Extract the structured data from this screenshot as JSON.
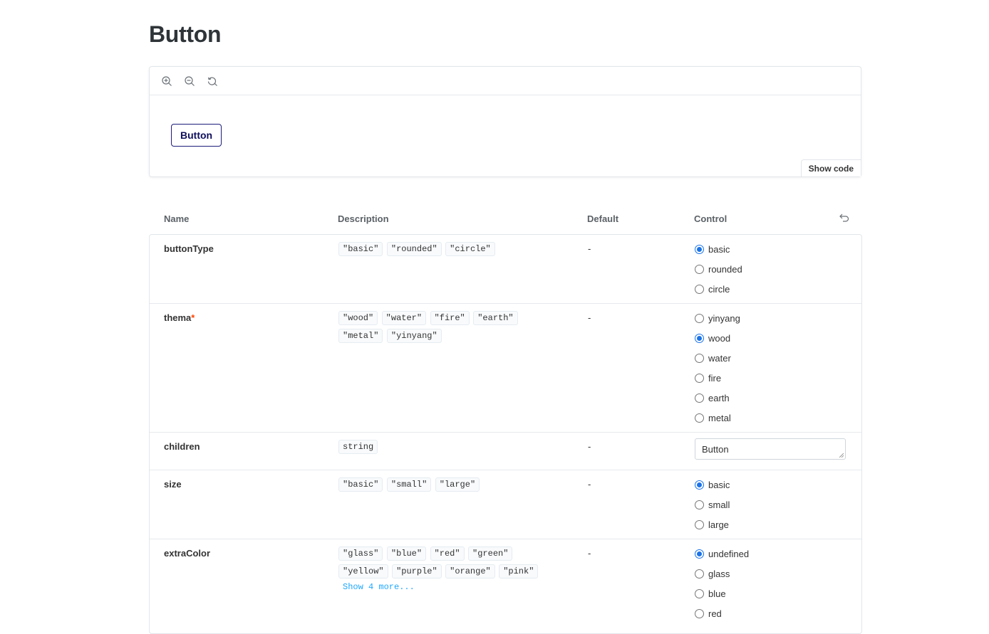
{
  "page": {
    "title": "Button"
  },
  "preview": {
    "tools": [
      {
        "icon": "zoom-in-icon"
      },
      {
        "icon": "zoom-out-icon"
      },
      {
        "icon": "reset-zoom-icon"
      }
    ],
    "demo_button_label": "Button",
    "show_code_label": "Show code"
  },
  "table": {
    "headers": {
      "name": "Name",
      "description": "Description",
      "default": "Default",
      "control": "Control"
    },
    "rows": [
      {
        "name": "buttonType",
        "required": "",
        "tokens": [
          "\"basic\"",
          "\"rounded\"",
          "\"circle\""
        ],
        "default": "-",
        "options": [
          "basic",
          "rounded",
          "circle"
        ],
        "selected": "basic"
      },
      {
        "name": "thema",
        "required": "*",
        "tokens": [
          "\"wood\"",
          "\"water\"",
          "\"fire\"",
          "\"earth\"",
          "\"metal\"",
          "\"yinyang\""
        ],
        "default": "-",
        "options": [
          "yinyang",
          "wood",
          "water",
          "fire",
          "earth",
          "metal"
        ],
        "selected": "wood"
      },
      {
        "name": "children",
        "required": "",
        "tokens": [
          "string"
        ],
        "default": "-",
        "input_value": "Button"
      },
      {
        "name": "size",
        "required": "",
        "tokens": [
          "\"basic\"",
          "\"small\"",
          "\"large\""
        ],
        "default": "-",
        "options": [
          "basic",
          "small",
          "large"
        ],
        "selected": "basic"
      },
      {
        "name": "extraColor",
        "required": "",
        "tokens": [
          "\"glass\"",
          "\"blue\"",
          "\"red\"",
          "\"green\"",
          "\"yellow\"",
          "\"purple\"",
          "\"orange\"",
          "\"pink\""
        ],
        "more_label": "Show 4 more...",
        "default": "-",
        "options": [
          "undefined",
          "glass",
          "blue",
          "red"
        ],
        "selected": "undefined"
      }
    ]
  },
  "colors": {
    "accent": "#1a73e8",
    "demo_border": "#1c1c7a",
    "link": "#1ea7fd",
    "required": "#ff4400"
  }
}
